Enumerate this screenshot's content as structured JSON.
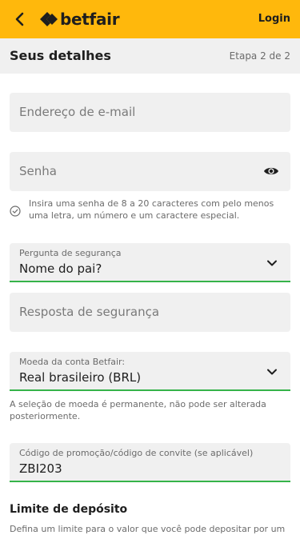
{
  "header": {
    "brand": "betfair",
    "login_label": "Login",
    "background_color": "#ffb80c"
  },
  "subheader": {
    "title": "Seus detalhes",
    "step": "Etapa 2 de 2"
  },
  "form": {
    "email": {
      "placeholder": "Endereço de e-mail"
    },
    "password": {
      "placeholder": "Senha",
      "hint": "Insira uma senha de 8 a 20 caracteres com pelo menos uma letra, um número e um caractere especial."
    },
    "security_question": {
      "label": "Pergunta de segurança",
      "value": "Nome do pai?"
    },
    "security_answer": {
      "placeholder": "Resposta de segurança"
    },
    "currency": {
      "label": "Moeda da conta Betfair:",
      "value": "Real brasileiro (BRL)",
      "note": "A seleção de moeda é permanente, não pode ser alterada posteriormente."
    },
    "promo_code": {
      "label": "Código de promoção/código de convite (se aplicável)",
      "value": "ZBI203"
    }
  },
  "deposit_limit": {
    "title": "Limite de depósito",
    "description": "Defina um limite para o valor que você pode depositar por um"
  },
  "colors": {
    "accent_green": "#36b34a",
    "field_bg": "#f0f0f0"
  }
}
